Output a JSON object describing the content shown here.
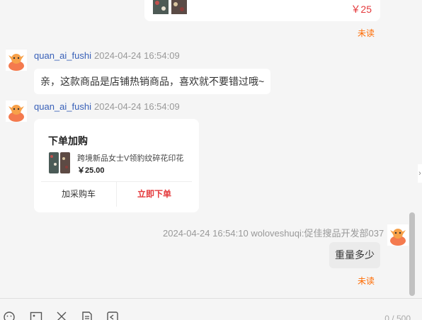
{
  "messages": {
    "top_card": {
      "price": "￥25"
    },
    "unread_1": "未读",
    "msg1": {
      "sender": "quan_ai_fushi",
      "time": "2024-04-24 16:54:09",
      "text": "亲，这款商品是店铺热销商品，喜欢就不要错过哦~"
    },
    "msg2": {
      "sender": "quan_ai_fushi",
      "time": "2024-04-24 16:54:09",
      "card": {
        "title": "下单加购",
        "product_name": "跨境新品女士V领豹纹碎花印花",
        "price": "￥25.00",
        "add_cart": "加采购车",
        "buy_now": "立即下单"
      }
    },
    "msg3": {
      "meta": "2024-04-24 16:54:10  woloveshuqi:促佳搜品开发部037",
      "text": "重量多少"
    },
    "unread_2": "未读"
  },
  "composer": {
    "counter": "0 / 500",
    "tools": [
      "emoji-icon",
      "image-icon",
      "scissors-icon",
      "order-doc-icon",
      "history-icon"
    ]
  },
  "colors": {
    "accent": "#ff6a00",
    "price": "#e4393c",
    "sender": "#3860b8"
  }
}
